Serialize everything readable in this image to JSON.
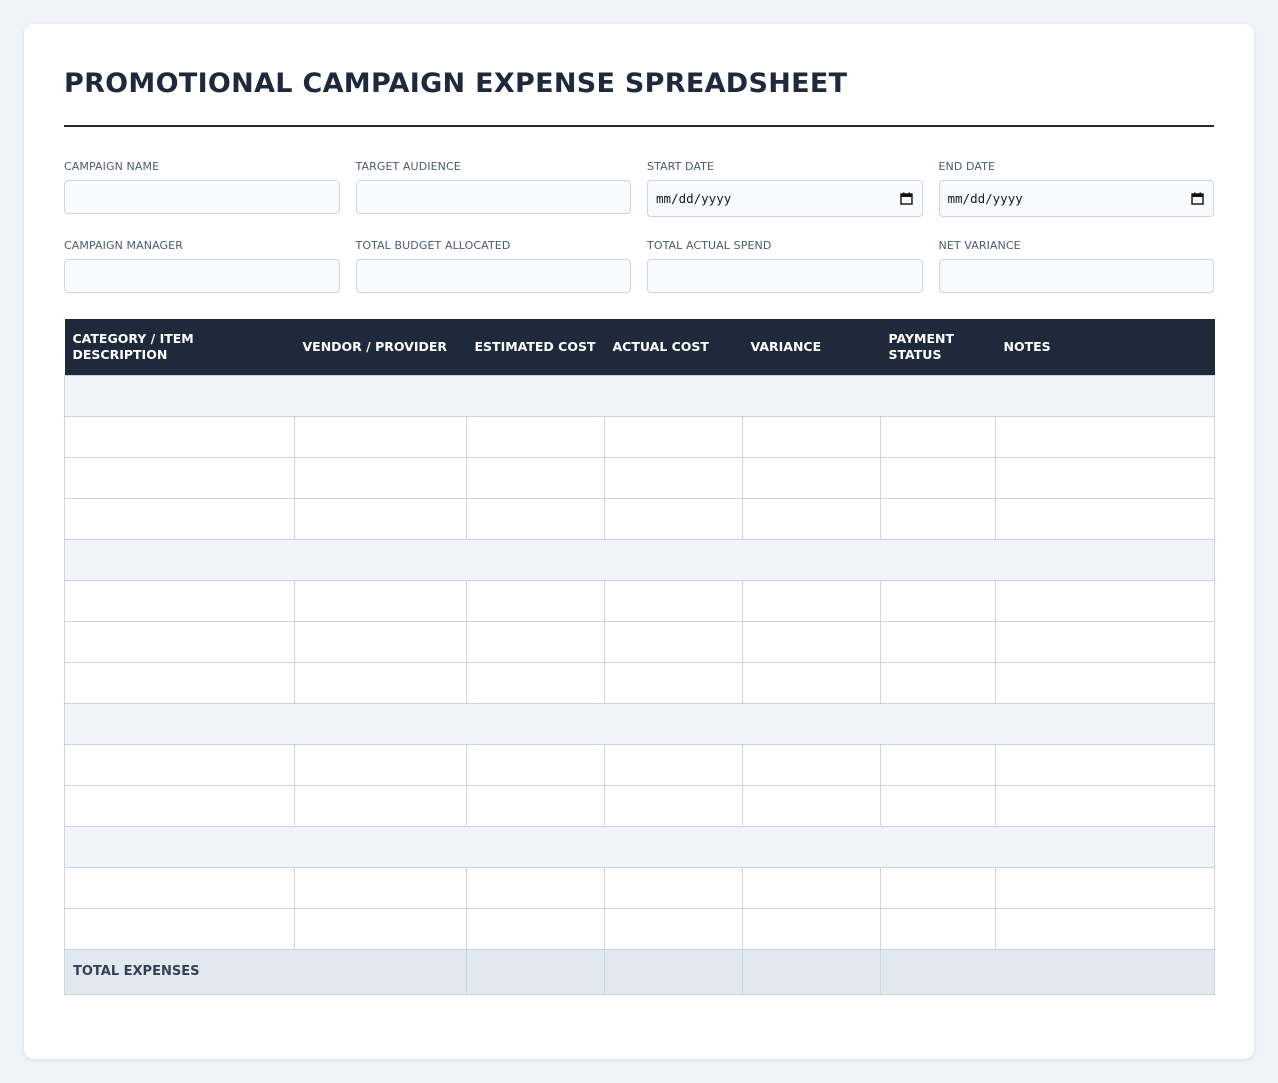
{
  "title": "PROMOTIONAL CAMPAIGN EXPENSE SPREADSHEET",
  "fields": {
    "campaign_name": {
      "label": "CAMPAIGN NAME",
      "value": ""
    },
    "target_audience": {
      "label": "TARGET AUDIENCE",
      "value": ""
    },
    "start_date": {
      "label": "START DATE",
      "placeholder": "mm/dd/yyyy"
    },
    "end_date": {
      "label": "END DATE",
      "placeholder": "mm/dd/yyyy"
    },
    "campaign_manager": {
      "label": "CAMPAIGN MANAGER",
      "value": ""
    },
    "total_budget": {
      "label": "TOTAL BUDGET ALLOCATED",
      "value": ""
    },
    "total_actual": {
      "label": "TOTAL ACTUAL SPEND",
      "value": ""
    },
    "net_variance": {
      "label": "NET VARIANCE",
      "value": ""
    }
  },
  "table": {
    "columns": [
      "CATEGORY / ITEM DESCRIPTION",
      "VENDOR / PROVIDER",
      "ESTIMATED COST",
      "ACTUAL COST",
      "VARIANCE",
      "PAYMENT STATUS",
      "NOTES"
    ],
    "total_label": "TOTAL EXPENSES"
  },
  "colors": {
    "header_bg": "#1e293b",
    "category_row_bg": "#f1f5f9",
    "total_row_bg": "#e2e8f0",
    "page_bg": "#f0f4f8"
  }
}
